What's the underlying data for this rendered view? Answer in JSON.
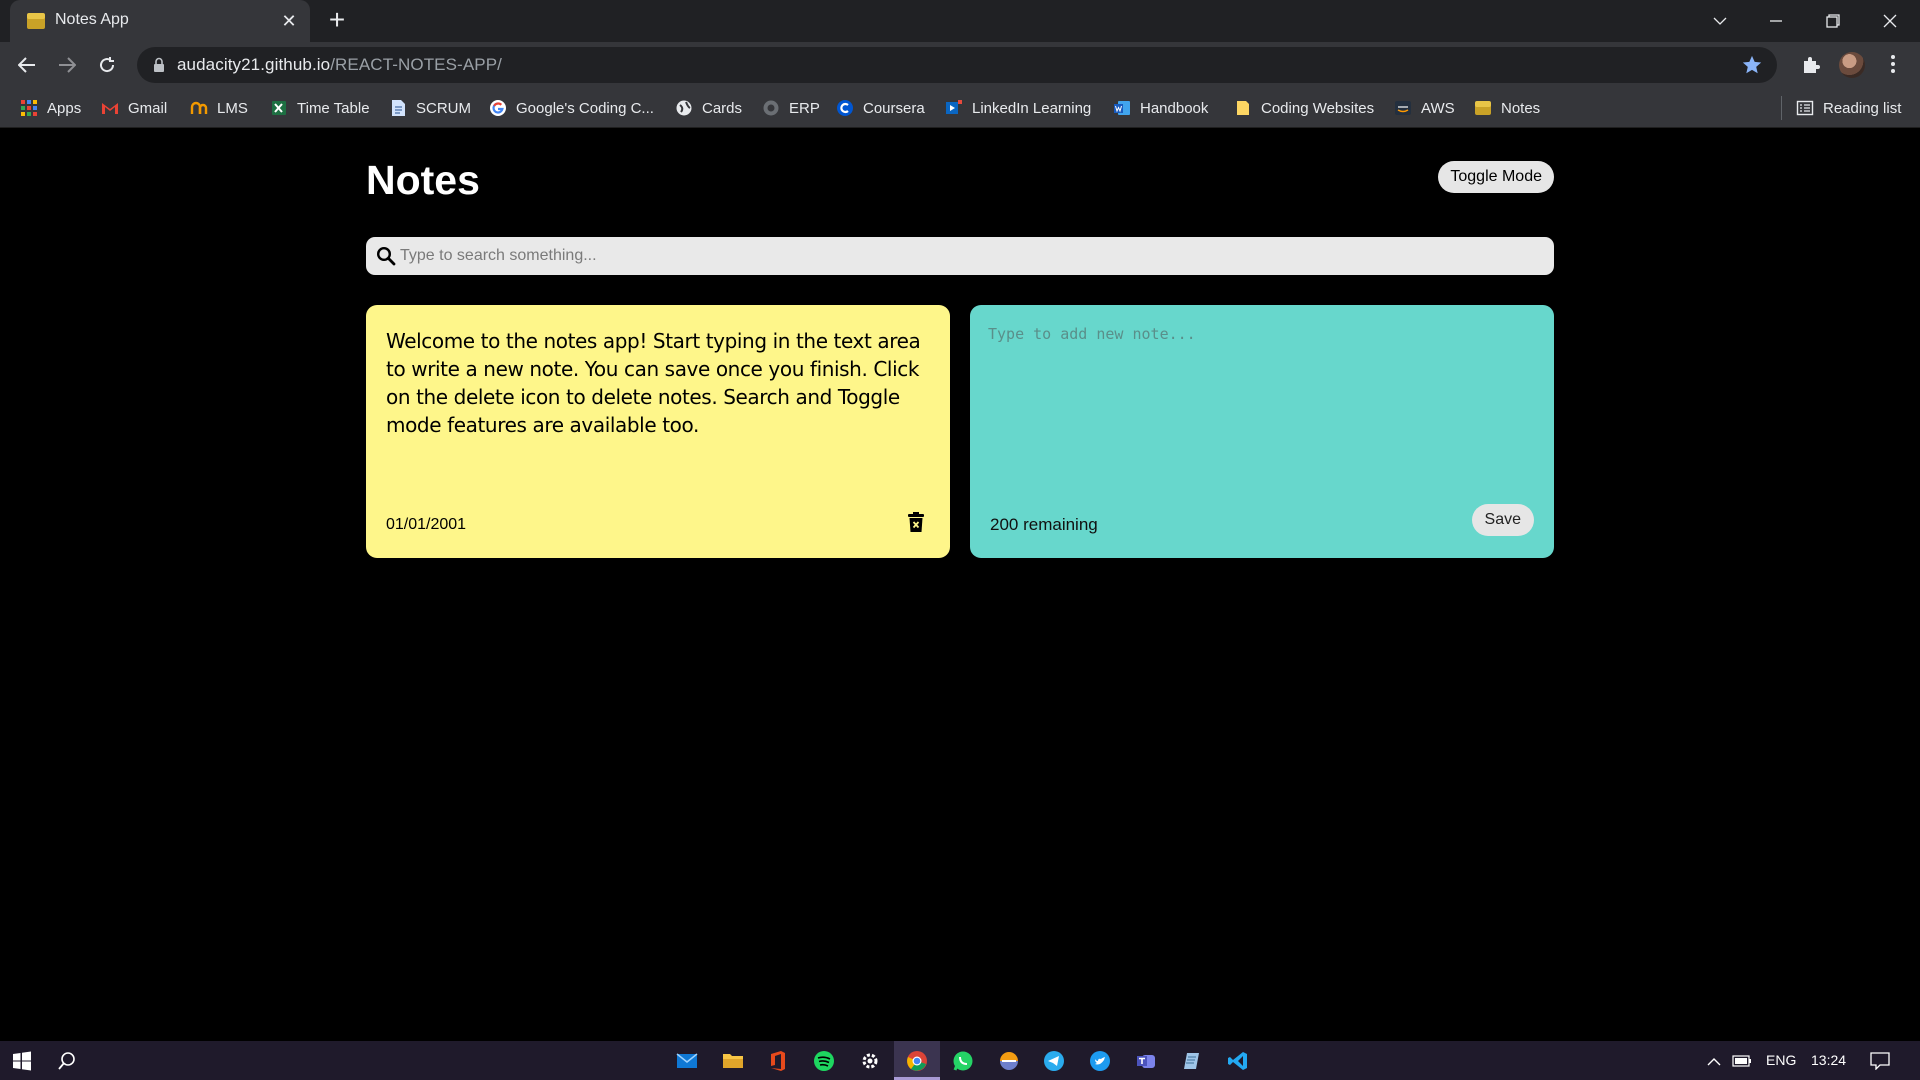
{
  "browser": {
    "tab_title": "Notes App",
    "url_host": "audacity21.github.io",
    "url_path": "/REACT-NOTES-APP/",
    "bookmarks": [
      {
        "label": "Apps",
        "icon": "apps-grid-icon"
      },
      {
        "label": "Gmail",
        "icon": "gmail-icon"
      },
      {
        "label": "LMS",
        "icon": "lms-icon"
      },
      {
        "label": "Time Table",
        "icon": "excel-icon"
      },
      {
        "label": "SCRUM",
        "icon": "document-icon"
      },
      {
        "label": "Google's Coding C...",
        "icon": "google-icon"
      },
      {
        "label": "Cards",
        "icon": "globe-icon"
      },
      {
        "label": "ERP",
        "icon": "erp-icon"
      },
      {
        "label": "Coursera",
        "icon": "coursera-icon"
      },
      {
        "label": "LinkedIn Learning",
        "icon": "linkedin-learning-icon"
      },
      {
        "label": "Handbook",
        "icon": "word-icon"
      },
      {
        "label": "Coding Websites",
        "icon": "folder-icon"
      },
      {
        "label": "AWS",
        "icon": "aws-icon"
      },
      {
        "label": "Notes",
        "icon": "notes-favicon-icon"
      }
    ],
    "reading_list": "Reading list"
  },
  "app": {
    "title": "Notes",
    "toggle_label": "Toggle Mode",
    "search_placeholder": "Type to search something...",
    "notes": [
      {
        "text": "Welcome to the notes app! Start typing in the text area to write a new note. You can save once you finish. Click on the delete icon to delete notes. Search and Toggle mode features are available too.",
        "date": "01/01/2001"
      }
    ],
    "new_note": {
      "placeholder": "Type to add new note...",
      "remaining": "200 remaining",
      "save_label": "Save"
    },
    "colors": {
      "background": "#000000",
      "note_yellow": "#fef68a",
      "note_new": "#67d7cc"
    }
  },
  "taskbar": {
    "apps": [
      "mail-icon",
      "file-explorer-icon",
      "office-icon",
      "spotify-icon",
      "settings-icon",
      "chrome-icon",
      "whatsapp-icon",
      "app-icon",
      "telegram-icon",
      "twitter-icon",
      "teams-icon",
      "notepad-icon",
      "vscode-icon"
    ],
    "language": "ENG",
    "time": "13:24"
  }
}
